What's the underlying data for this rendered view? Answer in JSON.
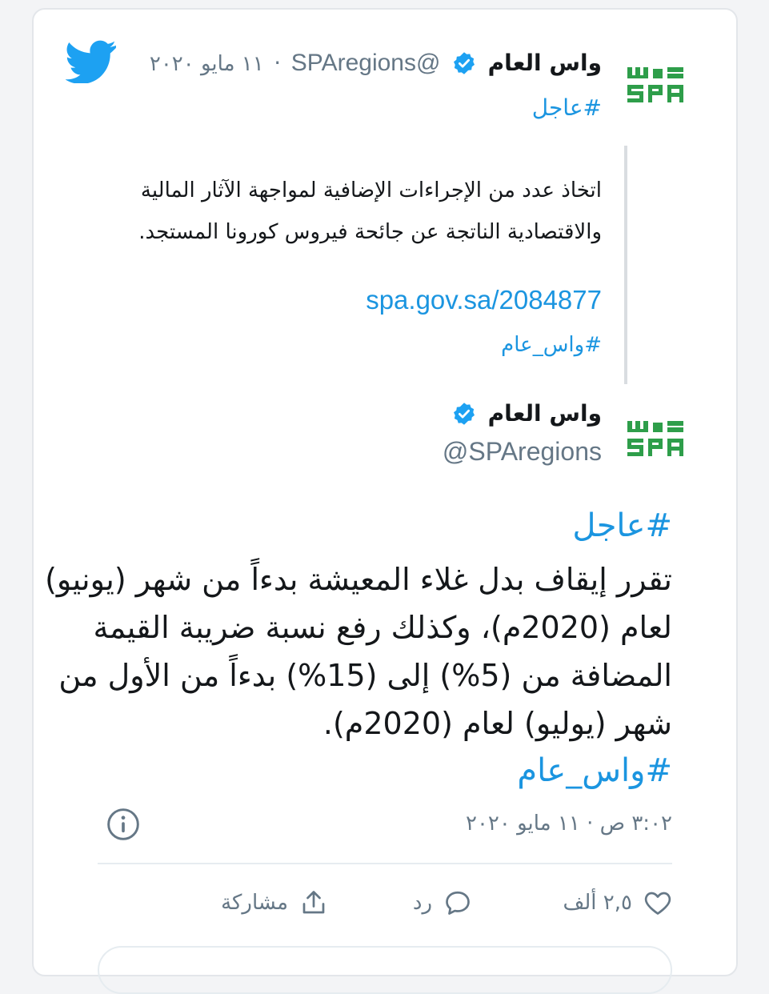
{
  "tweet": {
    "display_name": "واس العام",
    "handle": "@SPAregions",
    "separator": "·",
    "date": "١١ مايو ٢٠٢٠",
    "hashtag": "#عاجل"
  },
  "quoted": {
    "text": "اتخاذ عدد من الإجراءات الإضافية لمواجهة الآثار المالية والاقتصادية الناتجة عن جائحة فيروس كورونا المستجد.",
    "link": "spa.gov.sa/2084877",
    "hashtag": "#واس_عام"
  },
  "main": {
    "display_name": "واس العام",
    "handle": "@SPAregions",
    "hashtag": "#عاجل",
    "text": "تقرر إيقاف بدل غلاء المعيشة بدءاً من شهر (يونيو) لعام (2020م)، وكذلك رفع نسبة ضريبة القيمة المضافة من (5%) إلى (15%) بدءاً من الأول من شهر (يوليو) لعام (2020م).",
    "hashtag2": "#واس_عام",
    "timestamp": "٣:٠٢ ص · ١١ مايو ٢٠٢٠"
  },
  "actions": {
    "like_count": "٢,٥ ألف",
    "reply_label": "رد",
    "share_label": "مشاركة"
  },
  "colors": {
    "link": "#1b95e0",
    "muted": "#657786",
    "logo_green": "#2e9e4a",
    "twitter_blue": "#1da1f2"
  }
}
